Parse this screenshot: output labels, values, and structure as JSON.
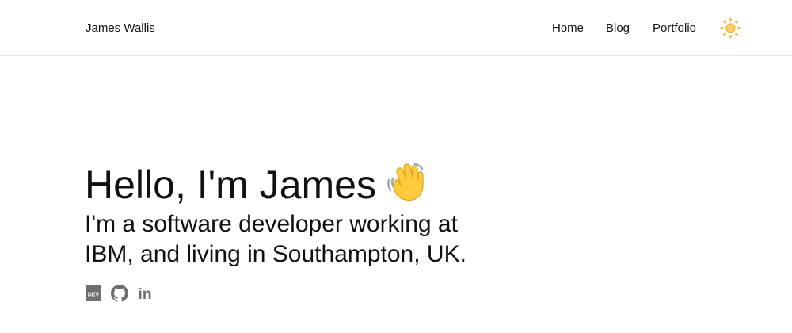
{
  "header": {
    "site_name": "James Wallis",
    "nav": [
      {
        "label": "Home"
      },
      {
        "label": "Blog"
      },
      {
        "label": "Portfolio"
      }
    ],
    "theme_toggle_icon": "sun-icon"
  },
  "hero": {
    "title": "Hello, I'm James",
    "title_emoji_icon": "waving-hand-icon",
    "subtitle": "I'm a software developer working at IBM, and living in Southampton, UK."
  },
  "social": [
    {
      "icon": "dev-icon",
      "label": "DEV"
    },
    {
      "icon": "github-icon"
    },
    {
      "icon": "linkedin-icon",
      "label": "in"
    }
  ],
  "colors": {
    "text": "#111111",
    "icon_gray": "#6e6e6e",
    "sun": "#f5b83d",
    "divider": "#e6e6e6"
  }
}
